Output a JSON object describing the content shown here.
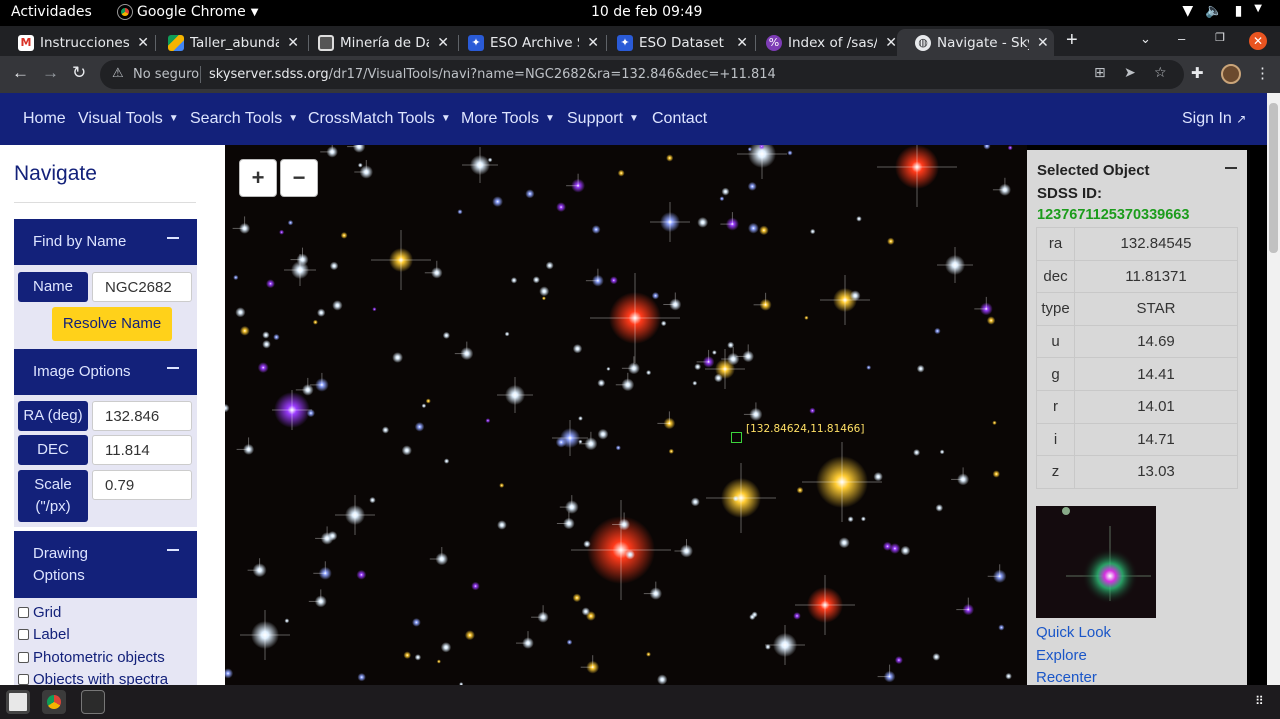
{
  "system": {
    "activities": "Actividades",
    "app_name": "Google Chrome",
    "clock": "10 de feb  09:49"
  },
  "tabs": [
    {
      "label": "Instrucciones",
      "favicon": "gmail-icon"
    },
    {
      "label": "Taller_abunda",
      "favicon": "drive-icon"
    },
    {
      "label": "Minería de Da",
      "favicon": "slides-icon"
    },
    {
      "label": "ESO Archive S",
      "favicon": "eso-icon"
    },
    {
      "label": "ESO Dataset",
      "favicon": "eso-icon"
    },
    {
      "label": "Index of /sas/",
      "favicon": "sas-icon"
    },
    {
      "label": "Navigate - Sky",
      "favicon": "globe-icon",
      "active": true
    }
  ],
  "address_bar": {
    "security": "No seguro",
    "host": "skyserver.sdss.org",
    "path": "/dr17/VisualTools/navi?name=NGC2682&ra=132.846&dec=+11.814"
  },
  "site_nav": {
    "items": [
      "Home",
      "Visual Tools",
      "Search Tools",
      "CrossMatch Tools",
      "More Tools",
      "Support",
      "Contact"
    ],
    "sign_in": "Sign In"
  },
  "left_panel": {
    "title": "Navigate",
    "find_by_name": {
      "header": "Find by Name",
      "name_label": "Name",
      "name_value": "NGC2682",
      "resolve_button": "Resolve Name"
    },
    "image_options": {
      "header": "Image Options",
      "ra_label": "RA (deg)",
      "ra_value": "132.846",
      "dec_label": "DEC (deg)",
      "dec_value": "11.814",
      "scale_label": "Scale",
      "scale_unit": "(\"/px)",
      "scale_value": "0.79"
    },
    "drawing_options": {
      "header_line1": "Drawing",
      "header_line2": "Options",
      "checkboxes": [
        "Grid",
        "Label",
        "Photometric objects",
        "Objects with spectra"
      ]
    }
  },
  "sky_view": {
    "zoom_in": "+",
    "zoom_out": "−",
    "marker_label": "[132.84624,11.81466]"
  },
  "selected_object": {
    "title": "Selected Object",
    "id_label": "SDSS ID:",
    "id_value": "1237671125370339663",
    "properties": [
      {
        "key": "ra",
        "value": "132.84545"
      },
      {
        "key": "dec",
        "value": "11.81371"
      },
      {
        "key": "type",
        "value": "STAR"
      },
      {
        "key": "u",
        "value": "14.69"
      },
      {
        "key": "g",
        "value": "14.41"
      },
      {
        "key": "r",
        "value": "14.01"
      },
      {
        "key": "i",
        "value": "14.71"
      },
      {
        "key": "z",
        "value": "13.03"
      }
    ],
    "links": [
      "Quick Look",
      "Explore",
      "Recenter"
    ]
  },
  "colors": {
    "nav_blue": "#13217a",
    "resolve_yellow": "#ffd11a",
    "id_green": "#1c9c1c",
    "link_blue": "#1a56c8",
    "marker_green": "#3bd43b",
    "marker_label_yellow": "#ffe066"
  }
}
